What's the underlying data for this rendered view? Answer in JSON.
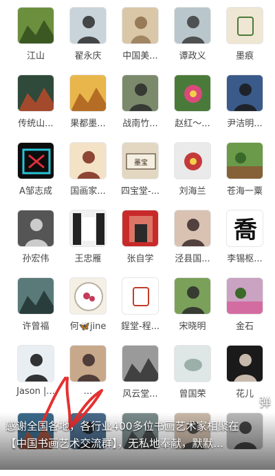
{
  "contacts": [
    {
      "name": "江山",
      "icon": "landscape-icon",
      "bg": "#6b8f3d",
      "fg": "#2f4a1c"
    },
    {
      "name": "翟永庆",
      "icon": "person-photo-icon",
      "bg": "#c9d3da",
      "fg": "#2b2b2b"
    },
    {
      "name": "中国美...",
      "icon": "painting-icon",
      "bg": "#d9c7a7",
      "fg": "#7a5a35"
    },
    {
      "name": "谭政义",
      "icon": "person-photo-icon",
      "bg": "#b9c6cc",
      "fg": "#3b3b3b"
    },
    {
      "name": "墨痕",
      "icon": "seal-icon",
      "bg": "#efe6d3",
      "fg": "#4a7a3a"
    },
    {
      "name": "传统山...",
      "icon": "mountain-painting-icon",
      "bg": "#2f4a3a",
      "fg": "#c14a2b"
    },
    {
      "name": "果都墨...",
      "icon": "autumn-mountain-icon",
      "bg": "#e8b64a",
      "fg": "#a85a1c"
    },
    {
      "name": "战南竹...",
      "icon": "person-photo-icon",
      "bg": "#7a8a6a",
      "fg": "#2a2a2a"
    },
    {
      "name": "赵红～...",
      "icon": "flower-icon",
      "bg": "#4a7a3a",
      "fg": "#d94a7a"
    },
    {
      "name": "尹洁明...",
      "icon": "person-photo-icon",
      "bg": "#3a5a8a",
      "fg": "#1a1a1a"
    },
    {
      "name": "A邹志成",
      "icon": "neon-logo-icon",
      "bg": "#0d0d0d",
      "fg": "#e02e3b"
    },
    {
      "name": "国画家...",
      "icon": "person-photo-icon",
      "bg": "#f3e2c6",
      "fg": "#7a2a1a"
    },
    {
      "name": "四宝堂-...",
      "icon": "calligraphy-scroll-icon",
      "bg": "#e3d7c2",
      "fg": "#3a2a1a"
    },
    {
      "name": "刘海兰",
      "icon": "flower-icon",
      "bg": "#eaeaea",
      "fg": "#c43a3a"
    },
    {
      "name": "苍海一粟",
      "icon": "garden-photo-icon",
      "bg": "#6a9a4a",
      "fg": "#9a3a2a"
    },
    {
      "name": "孙宏伟",
      "icon": "person-photo-icon",
      "bg": "#555555",
      "fg": "#e0e0e0"
    },
    {
      "name": "王忠雁",
      "icon": "book-cover-icon",
      "bg": "#f0f0f0",
      "fg": "#222222"
    },
    {
      "name": "张自学",
      "icon": "poster-icon",
      "bg": "#c82a2a",
      "fg": "#f7e6c0"
    },
    {
      "name": "泾县国...",
      "icon": "person-photo-icon",
      "bg": "#d9c2b2",
      "fg": "#3a2a2a"
    },
    {
      "name": "李锡枢...",
      "icon": "calligraphy-char-icon",
      "bg": "#ffffff",
      "fg": "#111111"
    },
    {
      "name": "许曾福",
      "icon": "ink-landscape-icon",
      "bg": "#5a7a7a",
      "fg": "#1e2e2e"
    },
    {
      "name": "何🦋jine",
      "icon": "round-painting-icon",
      "bg": "#f5f0e6",
      "fg": "#c43a5a"
    },
    {
      "name": "鋥堂-程...",
      "icon": "seal-icon",
      "bg": "#ffffff",
      "fg": "#c43a2a"
    },
    {
      "name": "宋晓明",
      "icon": "person-photo-icon",
      "bg": "#7aa05a",
      "fg": "#2a2a2a"
    },
    {
      "name": "金石",
      "icon": "garden-photo-icon",
      "bg": "#caa2c2",
      "fg": "#d94a8a"
    },
    {
      "name": "Jason |...",
      "icon": "person-photo-icon",
      "bg": "#e9eef3",
      "fg": "#111111"
    },
    {
      "name": "...",
      "icon": "person-photo-icon",
      "bg": "#c8a88a",
      "fg": "#3a2a2a"
    },
    {
      "name": "风云堂...",
      "icon": "ink-landscape-icon",
      "bg": "#9a9a9a",
      "fg": "#2a2a2a"
    },
    {
      "name": "曾国荣",
      "icon": "jade-icon",
      "bg": "#dfe6e6",
      "fg": "#9ab0a8"
    },
    {
      "name": "花儿",
      "icon": "person-photo-icon",
      "bg": "#1a1a1a",
      "fg": "#e8d6c8"
    },
    {
      "name": "",
      "icon": "landscape-icon",
      "bg": "#3a6a8a",
      "fg": "#b04a2a"
    },
    {
      "name": "",
      "icon": "person-photo-icon",
      "bg": "#4a6a8a",
      "fg": "#1a1a1a"
    },
    {
      "name": "",
      "icon": "ink-landscape-icon",
      "bg": "#7a8a8a",
      "fg": "#3a3a3a"
    },
    {
      "name": "",
      "icon": "person-photo-icon",
      "bg": "#c9b8a8",
      "fg": "#3a3a3a"
    },
    {
      "name": "",
      "icon": "person-photo-icon",
      "bg": "#b8b8b8",
      "fg": "#2a2a2a"
    }
  ],
  "overlay": {
    "danmu_label": "弹",
    "caption_line1": "感谢全国各地，各行业400多位书画艺术家相聚在",
    "caption_line2": "【中国书画艺术交流群】，无私地奉献，默默...",
    "scribble_color": "#e53030"
  }
}
